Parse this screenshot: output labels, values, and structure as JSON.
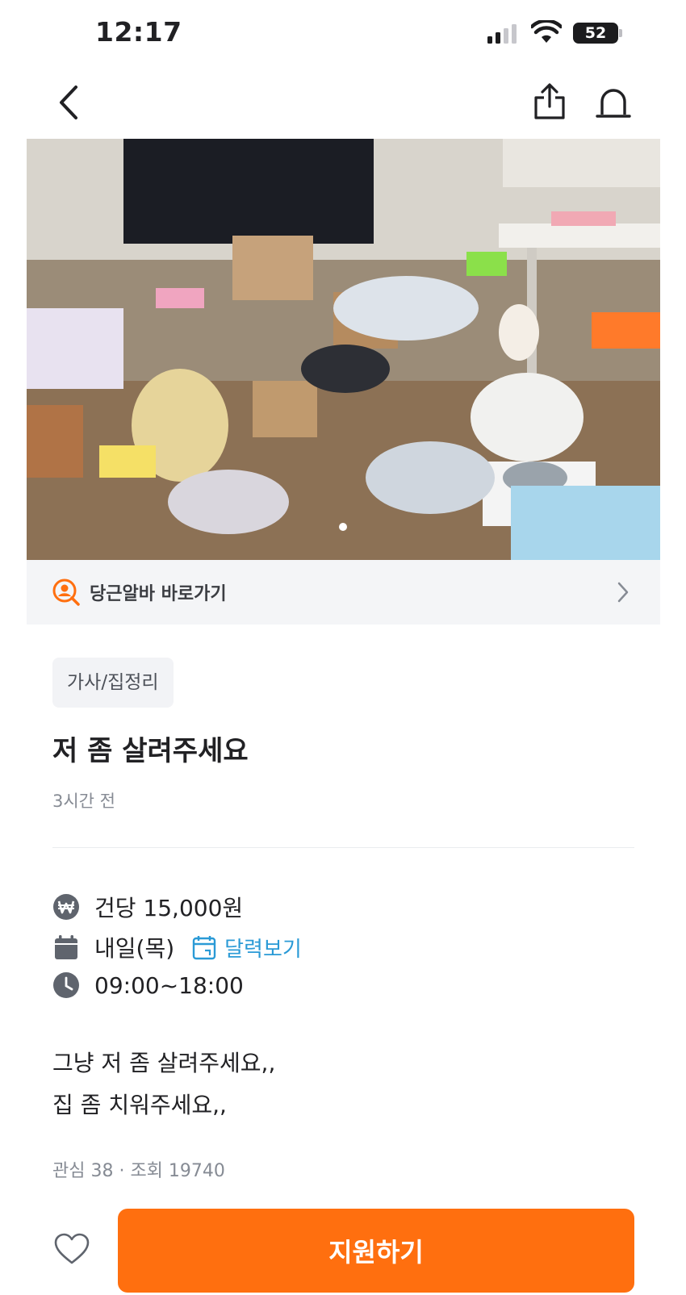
{
  "status_bar": {
    "time": "12:17",
    "battery": "52"
  },
  "header": {
    "back_icon": "chevron-left-icon",
    "share_icon": "share-icon",
    "alarm_icon": "siren-icon"
  },
  "banner": {
    "label": "당근알바 바로가기",
    "icon": "person-search-icon"
  },
  "post": {
    "category": "가사/집정리",
    "title": "저 좀 살려주세요",
    "posted_ago": "3시간 전",
    "pay": "건당 15,000원",
    "date": "내일(목)",
    "calendar_link": "달력보기",
    "time": "09:00~18:00",
    "description": [
      "그냥 저 좀 살려주세요,,",
      "집 좀 치워주세요,,"
    ],
    "stats": "관심 38 · 조회 19740"
  },
  "footer": {
    "apply_label": "지원하기"
  },
  "colors": {
    "accent": "#ff6f0f",
    "link": "#2a9ad6",
    "muted": "#868b94"
  }
}
